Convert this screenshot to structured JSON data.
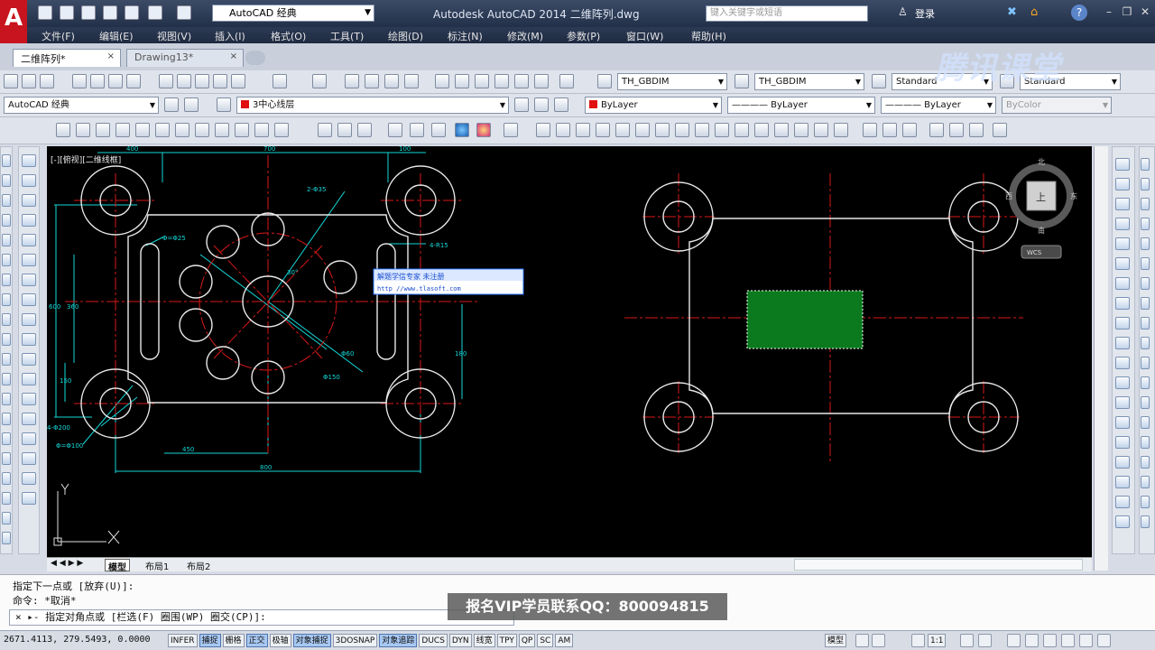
{
  "titlebar": {
    "logo_letter": "A",
    "workspace": "AutoCAD 经典",
    "title": "Autodesk AutoCAD 2014    二维阵列.dwg",
    "search_placeholder": "键入关键字或短语",
    "login": "登录"
  },
  "menus": [
    "文件(F)",
    "编辑(E)",
    "视图(V)",
    "插入(I)",
    "格式(O)",
    "工具(T)",
    "绘图(D)",
    "标注(N)",
    "修改(M)",
    "参数(P)",
    "窗口(W)",
    "帮助(H)"
  ],
  "tabs": [
    {
      "label": "二维阵列*",
      "close": "×"
    },
    {
      "label": "Drawing13*",
      "close": "×"
    }
  ],
  "toolbar": {
    "textstyle": "TH_GBDIM",
    "dimstyle": "TH_GBDIM",
    "tablestyle": "Standard",
    "mleaderstyle": "Standard",
    "workspace2": "AutoCAD 经典",
    "layer": "3中心线层",
    "color": "ByLayer",
    "linetype": "———— ByLayer",
    "lineweight": "———— ByLayer",
    "plotstyle": "ByColor"
  },
  "brandmark": "腾讯课堂",
  "viewcube": {
    "top": "上",
    "north": "北",
    "south": "南",
    "west": "西",
    "east": "东",
    "wcs": "WCS"
  },
  "left_drawing": {
    "title_label": "[-][俯视][二维线框]",
    "dims": {
      "top1": "400",
      "top2": "700",
      "top3": "100",
      "hole1": "2-Φ35",
      "hole2": "Φ=Φ25",
      "hole3": "4-R15",
      "angle": "30°",
      "d1": "Φ60",
      "d2": "Φ150",
      "left_h": "600",
      "left_h2": "360",
      "left_h3": "150",
      "bot1": "4-Φ200",
      "bot2": "Φ=Φ100",
      "bot3": "450",
      "bot4": "800",
      "right_h": "180"
    }
  },
  "tooltip": {
    "line1": "解题学信专家      未注册",
    "line2": "http //www.tlasoft.com"
  },
  "layout_tabs": [
    "模型",
    "布局1",
    "布局2"
  ],
  "command": {
    "line1": "指定下一点或 [放弃(U)]:",
    "line2": "命令: *取消*",
    "prompt": "×  ▸- 指定对角点或 [栏选(F) 圈围(WP) 圈交(CP)]:"
  },
  "watermark": "报名VIP学员联系QQ：800094815",
  "status": {
    "coords": "2671.4113, 279.5493, 0.0000",
    "toggles": [
      {
        "label": "INFER",
        "on": false
      },
      {
        "label": "捕捉",
        "on": true
      },
      {
        "label": "栅格",
        "on": false
      },
      {
        "label": "正交",
        "on": true
      },
      {
        "label": "极轴",
        "on": false
      },
      {
        "label": "对象捕捉",
        "on": true
      },
      {
        "label": "3DOSNAP",
        "on": false
      },
      {
        "label": "对象追踪",
        "on": true
      },
      {
        "label": "DUCS",
        "on": false
      },
      {
        "label": "DYN",
        "on": false
      },
      {
        "label": "线宽",
        "on": false
      },
      {
        "label": "TPY",
        "on": false
      },
      {
        "label": "QP",
        "on": false
      },
      {
        "label": "SC",
        "on": false
      },
      {
        "label": "AM",
        "on": false
      }
    ],
    "model": "模型",
    "scale": "1:1"
  },
  "colors": {
    "accent": "#2f8fd8",
    "selection": "#0b7a1e",
    "centerline": "#d81818",
    "dim": "#14d7d7"
  }
}
